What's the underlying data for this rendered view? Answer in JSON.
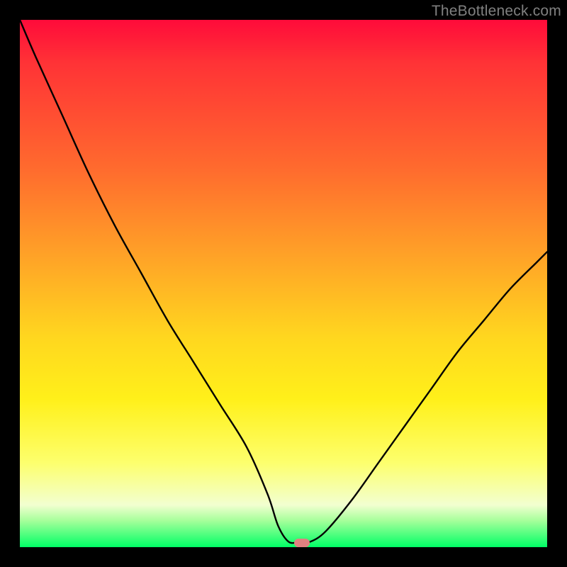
{
  "watermark": "TheBottleneck.com",
  "colors": {
    "frame": "#000000",
    "gradient_top": "#ff0b3a",
    "gradient_bottom": "#00ff66",
    "curve": "#000000",
    "marker": "#e08080",
    "watermark": "#808080"
  },
  "chart_data": {
    "type": "line",
    "title": "",
    "xlabel": "",
    "ylabel": "",
    "xlim": [
      0,
      100
    ],
    "ylim": [
      0,
      100
    ],
    "grid": false,
    "legend": false,
    "x": [
      0,
      3,
      8,
      13,
      18,
      23,
      28,
      33,
      38,
      43,
      47,
      49,
      51,
      53,
      55,
      58,
      63,
      68,
      73,
      78,
      83,
      88,
      93,
      98,
      100
    ],
    "values": [
      100,
      93,
      82,
      71,
      61,
      52,
      43,
      35,
      27,
      19,
      10,
      4,
      1,
      1,
      1,
      3,
      9,
      16,
      23,
      30,
      37,
      43,
      49,
      54,
      56
    ],
    "marker": {
      "x": 53.5,
      "y": 0.8
    }
  }
}
